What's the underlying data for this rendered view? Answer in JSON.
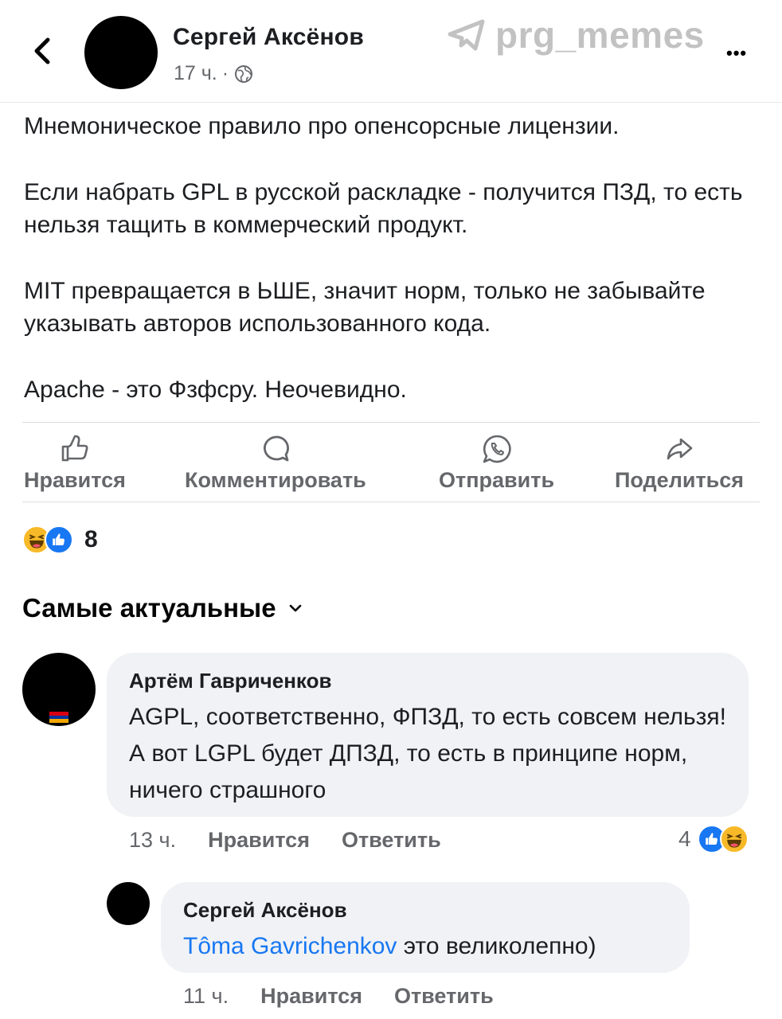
{
  "header": {
    "author": "Сергей Аксёнов",
    "time": "17 ч.",
    "separator": "·",
    "watermark": "prg_memes",
    "more_dots": "•••"
  },
  "post": {
    "paragraphs": [
      "Мнемоническое правило про опенсорсные лицензии.",
      "Если набрать GPL в русской раскладке - получится ПЗД, то есть нельзя тащить в коммерческий продукт.",
      "MIT превращается в ЬШЕ, значит норм, только не забывайте указывать авторов использованного кода.",
      "Apache - это Фзфсру. Неочевидно."
    ]
  },
  "actions": {
    "like": "Нравится",
    "comment": "Комментировать",
    "send": "Отправить",
    "share": "Поделиться"
  },
  "reactions": {
    "count": "8"
  },
  "comments_sort": {
    "label": "Самые актуальные"
  },
  "comments": [
    {
      "author": "Артём Гавриченков",
      "text": "AGPL, соответственно, ФПЗД, то есть совсем нельзя! А вот LGPL будет ДПЗД, то есть в принципе норм, ничего страшного",
      "time": "13 ч.",
      "like_label": "Нравится",
      "reply_label": "Ответить",
      "reaction_count": "4"
    }
  ],
  "reply": {
    "author": "Сергей Аксёнов",
    "mention": "Tôma Gavrichenkov",
    "text": " это великолепно)",
    "time": "11 ч.",
    "like_label": "Нравится",
    "reply_label": "Ответить"
  },
  "colors": {
    "link": "#1877f2",
    "secondary_text": "#65676b",
    "bubble": "#f0f2f5",
    "like_blue": "#1877f2",
    "haha_yellow": "#f7b928"
  }
}
